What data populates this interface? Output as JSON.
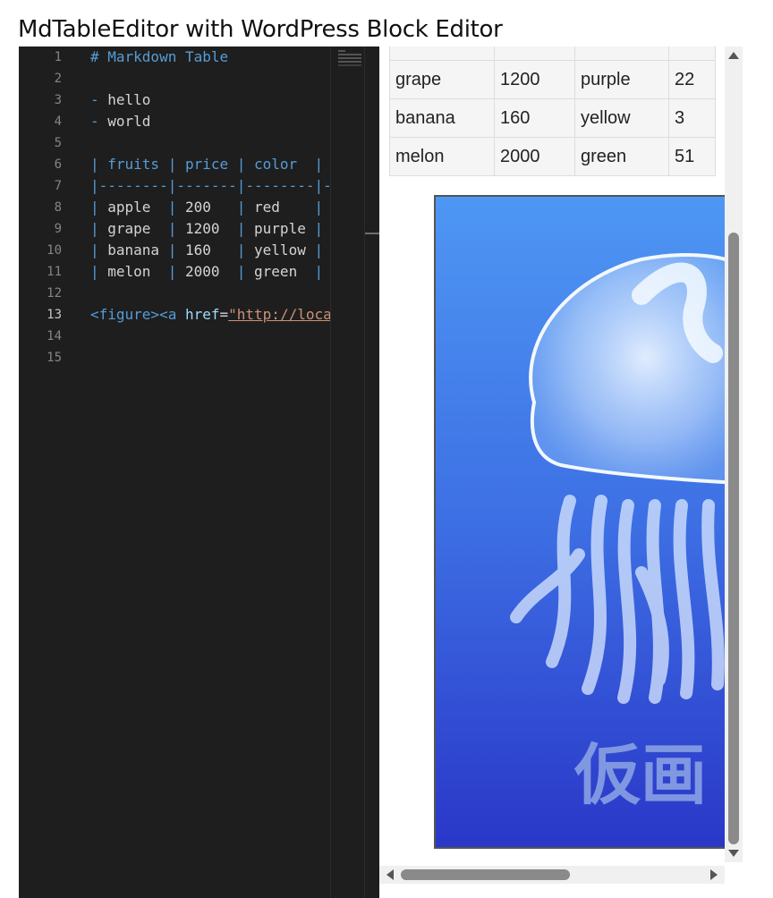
{
  "app": {
    "title": "MdTableEditor with WordPress Block Editor"
  },
  "editor": {
    "active_line": 13,
    "line_numbers": [
      "1",
      "2",
      "3",
      "4",
      "5",
      "6",
      "7",
      "8",
      "9",
      "10",
      "11",
      "12",
      "13",
      "14",
      "15"
    ],
    "lines": {
      "l1": "# Markdown Table",
      "l3_bullet": "- ",
      "l3_text": "hello",
      "l4_bullet": "- ",
      "l4_text": "world",
      "l6": "| fruits | price | color  |",
      "l7": "|--------|-------|--------|-",
      "l8_rows": [
        {
          "fruit": "apple ",
          "price": "200 ",
          "color": "red   "
        },
        {
          "fruit": "grape ",
          "price": "1200",
          "color": "purple"
        },
        {
          "fruit": "banana",
          "price": "160 ",
          "color": "yellow"
        },
        {
          "fruit": "melon ",
          "price": "2000",
          "color": "green "
        }
      ],
      "l13_tag": "<figure><a ",
      "l13_attr": "href",
      "l13_eq": "=",
      "l13_string": "\"http://loca"
    }
  },
  "preview": {
    "table_rows": [
      {
        "fruit": "",
        "price": "",
        "color": "",
        "count": ""
      },
      {
        "fruit": "grape",
        "price": "1200",
        "color": "purple",
        "count": "22"
      },
      {
        "fruit": "banana",
        "price": "160",
        "color": "yellow",
        "count": "3"
      },
      {
        "fruit": "melon",
        "price": "2000",
        "color": "green",
        "count": "51"
      }
    ],
    "image_caption_text": "仮画"
  },
  "colors": {
    "editor_bg": "#1e1e1e",
    "markdown_blue": "#569cd6",
    "string_orange": "#ce9178"
  }
}
